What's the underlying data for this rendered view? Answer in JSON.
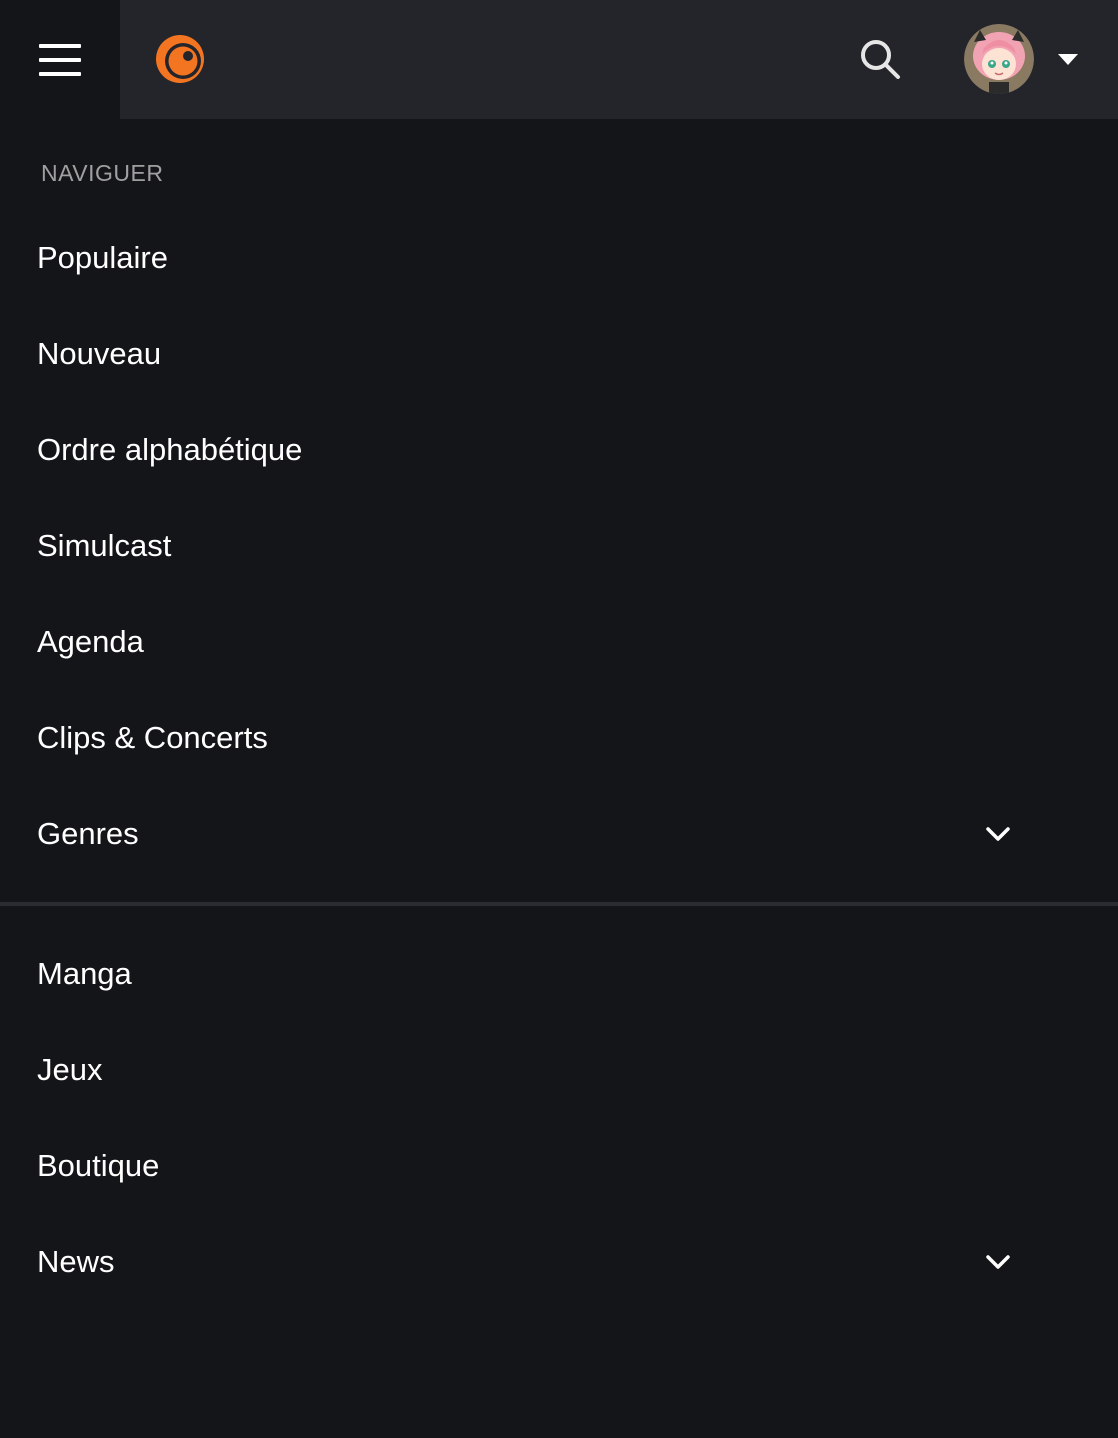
{
  "header": {
    "menu_icon": "hamburger-icon",
    "logo_icon": "crunchyroll-logo-icon",
    "search_icon": "search-icon",
    "avatar_icon": "user-avatar",
    "caret_icon": "caret-down-icon",
    "accent_color": "#f47521"
  },
  "nav": {
    "section_title": "NAVIGUER",
    "browse_items": [
      {
        "label": "Populaire"
      },
      {
        "label": "Nouveau"
      },
      {
        "label": "Ordre alphabétique"
      },
      {
        "label": "Simulcast"
      },
      {
        "label": "Agenda"
      },
      {
        "label": "Clips & Concerts"
      },
      {
        "label": "Genres",
        "expandable": true,
        "icon": "chevron-down-icon"
      }
    ],
    "extra_items": [
      {
        "label": "Manga"
      },
      {
        "label": "Jeux"
      },
      {
        "label": "Boutique"
      },
      {
        "label": "News",
        "expandable": true,
        "icon": "chevron-down-icon"
      }
    ]
  }
}
